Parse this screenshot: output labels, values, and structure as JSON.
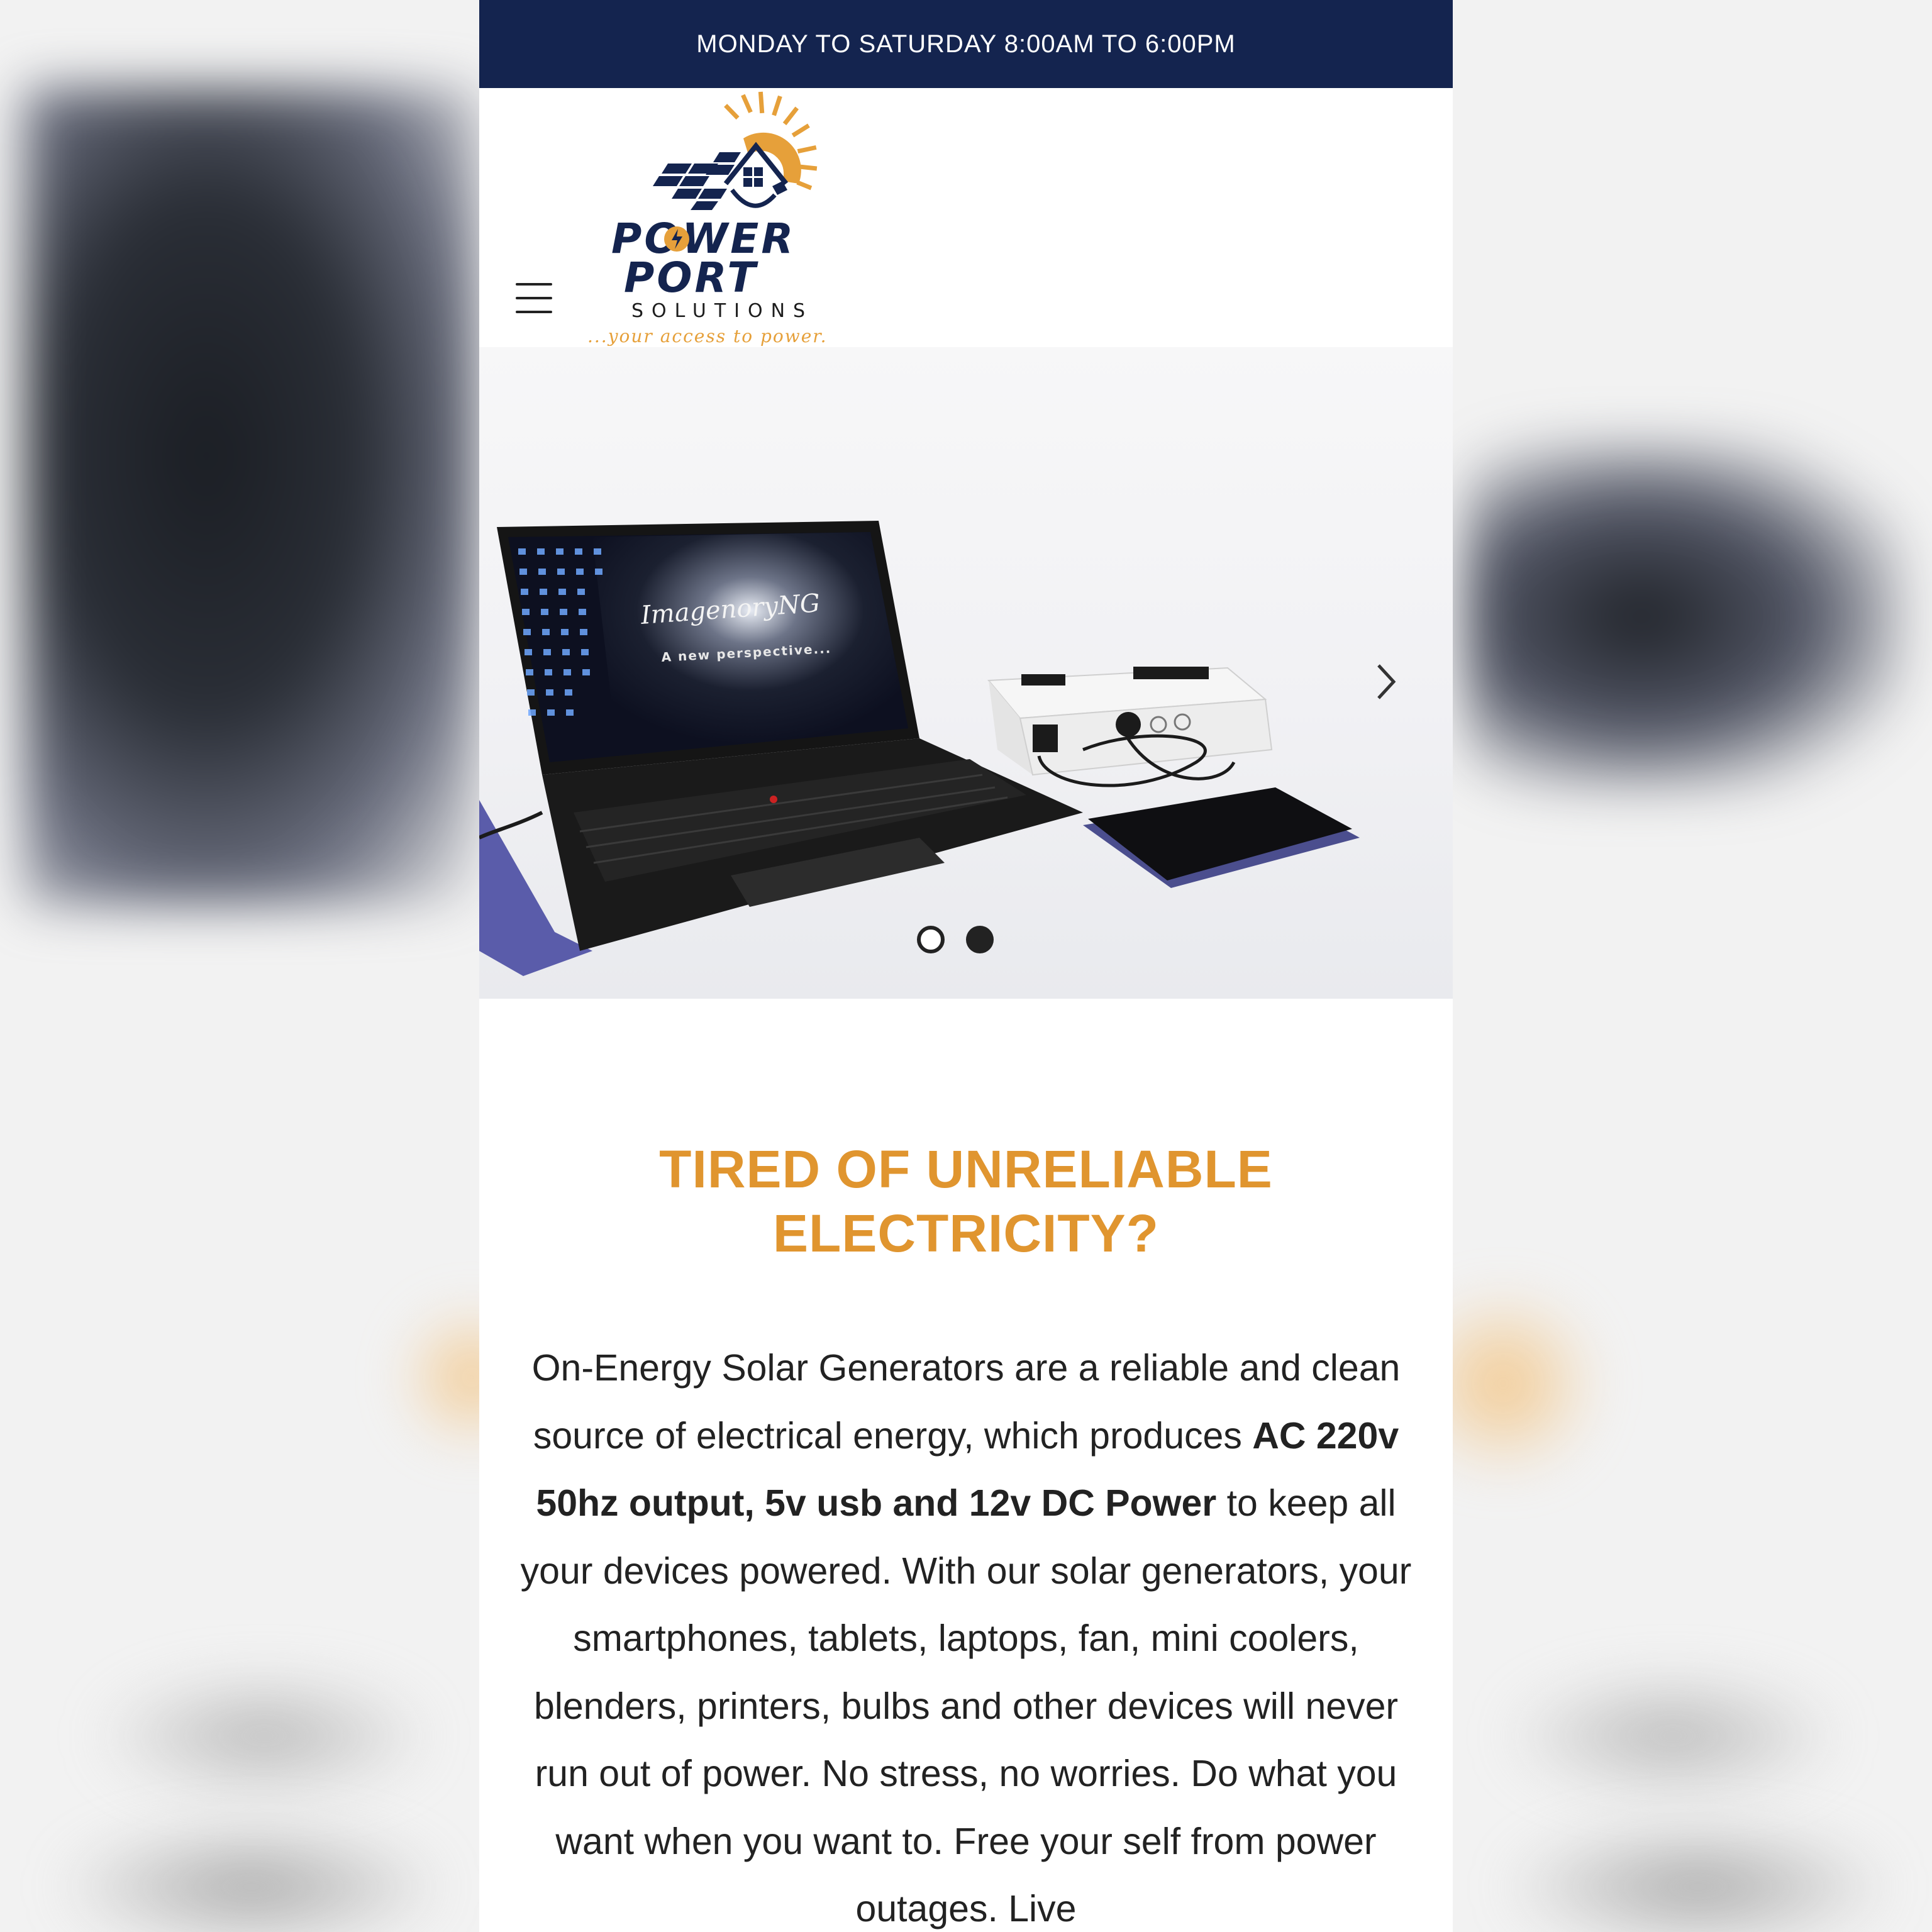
{
  "topbar": {
    "hours": "MONDAY TO SATURDAY 8:00AM TO 6:00PM"
  },
  "header": {
    "menu_icon": "hamburger-menu-icon",
    "logo": {
      "line1": "POWER",
      "line2": "PORT",
      "line3": "SOLUTIONS",
      "tagline": "...your access to power."
    }
  },
  "hero": {
    "screen_brand": "ImagenoryNG",
    "screen_caption": "A new perspective...",
    "next_icon": "chevron-right-icon",
    "slides_total": 2,
    "active_slide": 2
  },
  "section": {
    "headline_line1": "TIRED OF UNRELIABLE",
    "headline_line2": "ELECTRICITY?",
    "para_intro": "On-Energy Solar Generators are a reliable and clean source of electrical energy, which produces ",
    "para_bold": "AC 220v 50hz output, 5v usb and 12v DC Power",
    "para_rest": " to keep all your devices powered. With our solar generators, your smartphones, tablets, laptops, fan, mini coolers, blenders, printers, bulbs and other devices will never run out of power. No stress, no worries. Do what you want when you want to. Free your self from power outages. Live"
  },
  "colors": {
    "navy": "#14244f",
    "orange": "#e0952f",
    "text": "#222222"
  }
}
